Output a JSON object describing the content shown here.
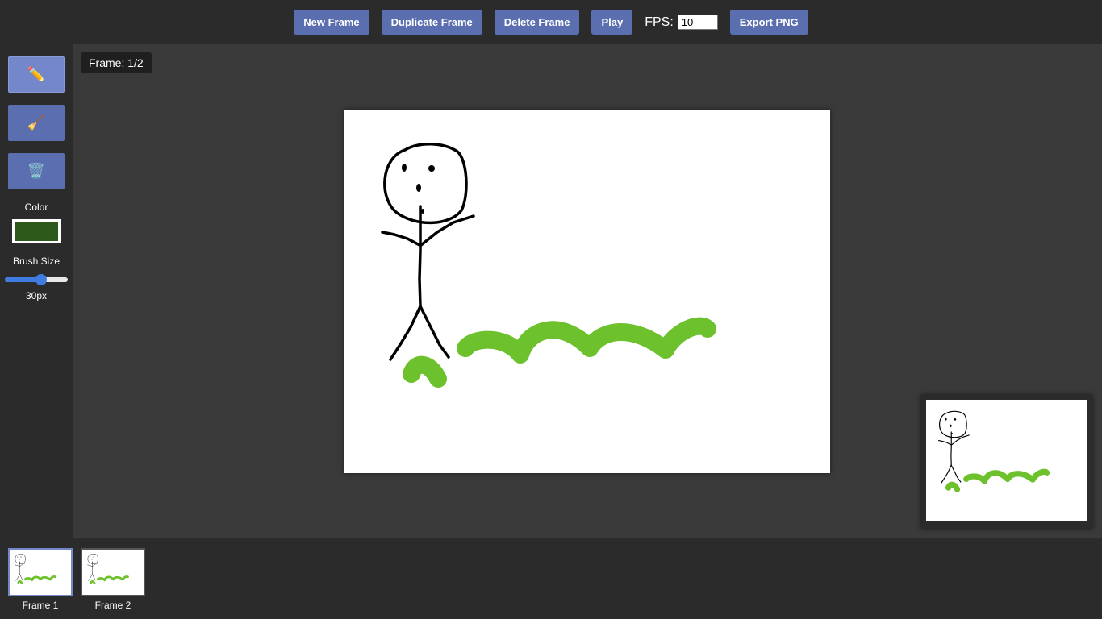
{
  "toolbar": {
    "new_frame": "New Frame",
    "duplicate_frame": "Duplicate Frame",
    "delete_frame": "Delete Frame",
    "play": "Play",
    "fps_label": "FPS:",
    "fps_value": "10",
    "export_png": "Export PNG"
  },
  "tools": [
    {
      "name": "pencil",
      "icon": "✏️",
      "active": true
    },
    {
      "name": "eraser",
      "icon": "🧹",
      "active": false
    },
    {
      "name": "clear",
      "icon": "🗑️",
      "active": false
    }
  ],
  "color": {
    "label": "Color",
    "value": "#2d5a1b"
  },
  "brush": {
    "label": "Brush Size",
    "value_label": "30px",
    "fraction": 0.6
  },
  "frame_indicator": "Frame: 1/2",
  "timeline": {
    "frames": [
      {
        "label": "Frame 1",
        "active": true
      },
      {
        "label": "Frame 2",
        "active": false
      }
    ]
  },
  "stroke_colors": {
    "ink": "#000000",
    "grass": "#6cc12c"
  }
}
